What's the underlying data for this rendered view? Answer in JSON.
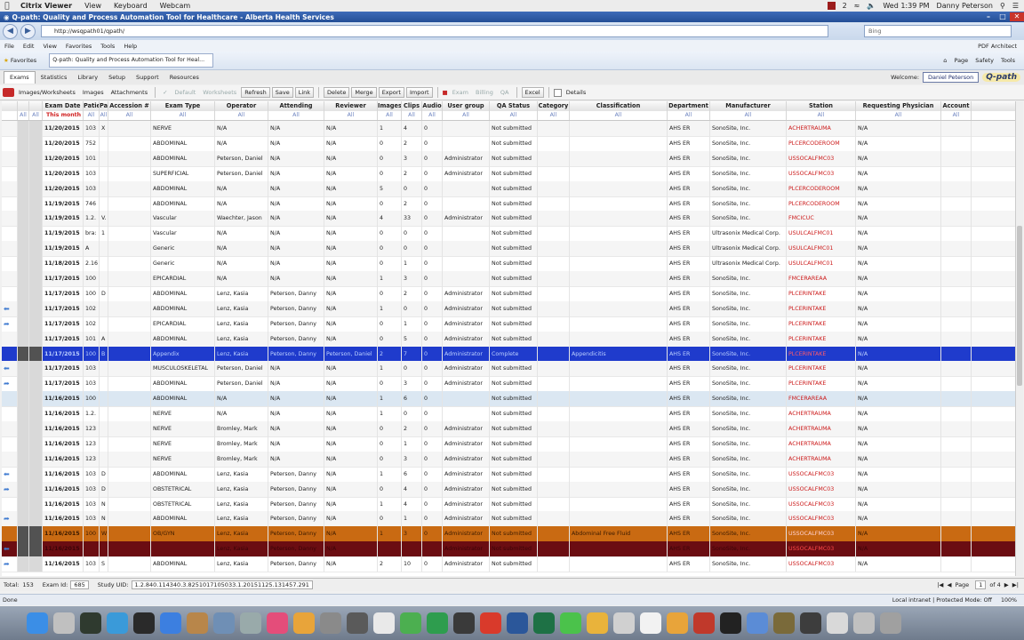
{
  "mac_menubar": {
    "app_name": "Citrix Viewer",
    "items": [
      "View",
      "Keyboard",
      "Webcam"
    ],
    "badge": "2",
    "clock": "Wed 1:39 PM",
    "user": "Danny Peterson"
  },
  "window": {
    "title": "Q-path: Quality and Process Automation Tool for Healthcare - Alberta Health Services"
  },
  "browser": {
    "url": "http://wsqpath01/qpath/",
    "search_placeholder": "Bing",
    "menu": [
      "File",
      "Edit",
      "View",
      "Favorites",
      "Tools",
      "Help"
    ],
    "pdf_architect": "PDF Architect",
    "favorites_label": "Favorites",
    "tab_title": "Q-path: Quality and Process Automation Tool for Heal...",
    "tools": [
      "Page",
      "Safety",
      "Tools"
    ]
  },
  "app": {
    "tabs": [
      "Exams",
      "Statistics",
      "Library",
      "Setup",
      "Support",
      "Resources"
    ],
    "welcome_label": "Welcome:",
    "user": "Daniel Peterson",
    "logo": "Q-path",
    "toolbar": {
      "images_worksheets": "Images/Worksheets",
      "images": "Images",
      "attachments": "Attachments",
      "default": "Default",
      "worksheets": "Worksheets",
      "refresh": "Refresh",
      "save": "Save",
      "link": "Link",
      "delete": "Delete",
      "merge": "Merge",
      "export": "Export",
      "import": "Import",
      "exam": "Exam",
      "billing": "Billing",
      "qa": "QA",
      "excel": "Excel",
      "details": "Details"
    }
  },
  "grid": {
    "columns": [
      "",
      "",
      "",
      "Exam Date",
      "Patie",
      "Pa",
      "Accession #",
      "Exam Type",
      "Operator",
      "Attending",
      "Reviewer",
      "Images",
      "Clips",
      "Audio",
      "User group",
      "QA Status",
      "Category",
      "Classification",
      "Department",
      "Manufacturer",
      "Station",
      "Requesting Physician",
      "Account"
    ],
    "filter_all": "All",
    "this_month": "This month",
    "rows": [
      {
        "style": "alt",
        "icon": "",
        "date": "11/20/2015",
        "pid": "103",
        "pa": "X",
        "acc": "",
        "type": "NERVE",
        "op": "N/A",
        "att": "N/A",
        "rev": "N/A",
        "img": "1",
        "clips": "4",
        "audio": "0",
        "ug": "",
        "qa": "Not submitted",
        "cat": "",
        "cls": "",
        "dept": "AHS ER",
        "mfr": "SonoSite, Inc.",
        "station": "ACHERTRAUMA",
        "req": "N/A"
      },
      {
        "style": "",
        "icon": "",
        "date": "11/20/2015",
        "pid": "752",
        "pa": "",
        "acc": "",
        "type": "ABDOMINAL",
        "op": "N/A",
        "att": "N/A",
        "rev": "N/A",
        "img": "0",
        "clips": "2",
        "audio": "0",
        "ug": "",
        "qa": "Not submitted",
        "cat": "",
        "cls": "",
        "dept": "AHS ER",
        "mfr": "SonoSite, Inc.",
        "station": "PLCERCODEROOM",
        "req": "N/A"
      },
      {
        "style": "alt",
        "icon": "",
        "date": "11/20/2015",
        "pid": "101",
        "pa": "",
        "acc": "",
        "type": "ABDOMINAL",
        "op": "Peterson, Daniel",
        "att": "N/A",
        "rev": "N/A",
        "img": "0",
        "clips": "3",
        "audio": "0",
        "ug": "Administrator",
        "qa": "Not submitted",
        "cat": "",
        "cls": "",
        "dept": "AHS ER",
        "mfr": "SonoSite, Inc.",
        "station": "USSOCALFMC03",
        "req": "N/A"
      },
      {
        "style": "",
        "icon": "",
        "date": "11/20/2015",
        "pid": "103",
        "pa": "",
        "acc": "",
        "type": "SUPERFICIAL",
        "op": "Peterson, Daniel",
        "att": "N/A",
        "rev": "N/A",
        "img": "0",
        "clips": "2",
        "audio": "0",
        "ug": "Administrator",
        "qa": "Not submitted",
        "cat": "",
        "cls": "",
        "dept": "AHS ER",
        "mfr": "SonoSite, Inc.",
        "station": "USSOCALFMC03",
        "req": "N/A"
      },
      {
        "style": "alt",
        "icon": "",
        "date": "11/20/2015",
        "pid": "103",
        "pa": "",
        "acc": "",
        "type": "ABDOMINAL",
        "op": "N/A",
        "att": "N/A",
        "rev": "N/A",
        "img": "5",
        "clips": "0",
        "audio": "0",
        "ug": "",
        "qa": "Not submitted",
        "cat": "",
        "cls": "",
        "dept": "AHS ER",
        "mfr": "SonoSite, Inc.",
        "station": "PLCERCODEROOM",
        "req": "N/A"
      },
      {
        "style": "",
        "icon": "",
        "date": "11/19/2015",
        "pid": "746",
        "pa": "",
        "acc": "",
        "type": "ABDOMINAL",
        "op": "N/A",
        "att": "N/A",
        "rev": "N/A",
        "img": "0",
        "clips": "2",
        "audio": "0",
        "ug": "",
        "qa": "Not submitted",
        "cat": "",
        "cls": "",
        "dept": "AHS ER",
        "mfr": "SonoSite, Inc.",
        "station": "PLCERCODEROOM",
        "req": "N/A"
      },
      {
        "style": "alt",
        "icon": "",
        "date": "11/19/2015",
        "pid": "1.2.",
        "pa": "V.",
        "acc": "",
        "type": "Vascular",
        "op": "Waechter, Jason",
        "att": "N/A",
        "rev": "N/A",
        "img": "4",
        "clips": "33",
        "audio": "0",
        "ug": "Administrator",
        "qa": "Not submitted",
        "cat": "",
        "cls": "",
        "dept": "AHS ER",
        "mfr": "SonoSite, Inc.",
        "station": "FMCICUC",
        "req": "N/A"
      },
      {
        "style": "",
        "icon": "",
        "date": "11/19/2015",
        "pid": "bra:",
        "pa": "1",
        "acc": "",
        "type": "Vascular",
        "op": "N/A",
        "att": "N/A",
        "rev": "N/A",
        "img": "0",
        "clips": "0",
        "audio": "0",
        "ug": "",
        "qa": "Not submitted",
        "cat": "",
        "cls": "",
        "dept": "AHS ER",
        "mfr": "Ultrasonix Medical Corp.",
        "station": "USULCALFMC01",
        "req": "N/A"
      },
      {
        "style": "alt",
        "icon": "",
        "date": "11/19/2015",
        "pid": "A",
        "pa": "",
        "acc": "",
        "type": "Generic",
        "op": "N/A",
        "att": "N/A",
        "rev": "N/A",
        "img": "0",
        "clips": "0",
        "audio": "0",
        "ug": "",
        "qa": "Not submitted",
        "cat": "",
        "cls": "",
        "dept": "AHS ER",
        "mfr": "Ultrasonix Medical Corp.",
        "station": "USULCALFMC01",
        "req": "N/A"
      },
      {
        "style": "",
        "icon": "",
        "date": "11/18/2015",
        "pid": "2.16",
        "pa": "",
        "acc": "",
        "type": "Generic",
        "op": "N/A",
        "att": "N/A",
        "rev": "N/A",
        "img": "0",
        "clips": "1",
        "audio": "0",
        "ug": "",
        "qa": "Not submitted",
        "cat": "",
        "cls": "",
        "dept": "AHS ER",
        "mfr": "Ultrasonix Medical Corp.",
        "station": "USULCALFMC01",
        "req": "N/A"
      },
      {
        "style": "alt",
        "icon": "",
        "date": "11/17/2015",
        "pid": "100",
        "pa": "",
        "acc": "",
        "type": "EPICARDIAL",
        "op": "N/A",
        "att": "N/A",
        "rev": "N/A",
        "img": "1",
        "clips": "3",
        "audio": "0",
        "ug": "",
        "qa": "Not submitted",
        "cat": "",
        "cls": "",
        "dept": "AHS ER",
        "mfr": "SonoSite, Inc.",
        "station": "FMCERAREAA",
        "req": "N/A"
      },
      {
        "style": "",
        "icon": "",
        "date": "11/17/2015",
        "pid": "100",
        "pa": "D",
        "acc": "",
        "type": "ABDOMINAL",
        "op": "Lenz, Kasia",
        "att": "Peterson, Danny",
        "rev": "N/A",
        "img": "0",
        "clips": "2",
        "audio": "0",
        "ug": "Administrator",
        "qa": "Not submitted",
        "cat": "",
        "cls": "",
        "dept": "AHS ER",
        "mfr": "SonoSite, Inc.",
        "station": "PLCERINTAKE",
        "req": "N/A"
      },
      {
        "style": "alt",
        "icon": "back",
        "date": "11/17/2015",
        "pid": "102",
        "pa": "",
        "acc": "",
        "type": "ABDOMINAL",
        "op": "Lenz, Kasia",
        "att": "Peterson, Danny",
        "rev": "N/A",
        "img": "1",
        "clips": "0",
        "audio": "0",
        "ug": "Administrator",
        "qa": "Not submitted",
        "cat": "",
        "cls": "",
        "dept": "AHS ER",
        "mfr": "SonoSite, Inc.",
        "station": "PLCERINTAKE",
        "req": "N/A"
      },
      {
        "style": "",
        "icon": "fwd",
        "date": "11/17/2015",
        "pid": "102",
        "pa": "",
        "acc": "",
        "type": "EPICARDIAL",
        "op": "Lenz, Kasia",
        "att": "Peterson, Danny",
        "rev": "N/A",
        "img": "0",
        "clips": "1",
        "audio": "0",
        "ug": "Administrator",
        "qa": "Not submitted",
        "cat": "",
        "cls": "",
        "dept": "AHS ER",
        "mfr": "SonoSite, Inc.",
        "station": "PLCERINTAKE",
        "req": "N/A"
      },
      {
        "style": "alt",
        "icon": "",
        "date": "11/17/2015",
        "pid": "101",
        "pa": "A",
        "acc": "",
        "type": "ABDOMINAL",
        "op": "Lenz, Kasia",
        "att": "Peterson, Danny",
        "rev": "N/A",
        "img": "0",
        "clips": "5",
        "audio": "0",
        "ug": "Administrator",
        "qa": "Not submitted",
        "cat": "",
        "cls": "",
        "dept": "AHS ER",
        "mfr": "SonoSite, Inc.",
        "station": "PLCERINTAKE",
        "req": "N/A"
      },
      {
        "style": "blue",
        "icon": "",
        "date": "11/17/2015",
        "pid": "100",
        "pa": "B",
        "acc": "",
        "type": "Appendix",
        "op": "Lenz, Kasia",
        "att": "Peterson, Danny",
        "rev": "Peterson, Daniel",
        "img": "2",
        "clips": "7",
        "audio": "0",
        "ug": "Administrator",
        "qa": "Complete",
        "cat": "",
        "cls": "Appendicitis",
        "dept": "AHS ER",
        "mfr": "SonoSite, Inc.",
        "station": "PLCERINTAKE",
        "req": "N/A"
      },
      {
        "style": "alt",
        "icon": "back",
        "date": "11/17/2015",
        "pid": "103",
        "pa": "",
        "acc": "",
        "type": "MUSCULOSKELETAL",
        "op": "Peterson, Daniel",
        "att": "N/A",
        "rev": "N/A",
        "img": "1",
        "clips": "0",
        "audio": "0",
        "ug": "Administrator",
        "qa": "Not submitted",
        "cat": "",
        "cls": "",
        "dept": "AHS ER",
        "mfr": "SonoSite, Inc.",
        "station": "PLCERINTAKE",
        "req": "N/A"
      },
      {
        "style": "",
        "icon": "fwd",
        "date": "11/17/2015",
        "pid": "103",
        "pa": "",
        "acc": "",
        "type": "ABDOMINAL",
        "op": "Peterson, Daniel",
        "att": "N/A",
        "rev": "N/A",
        "img": "0",
        "clips": "3",
        "audio": "0",
        "ug": "Administrator",
        "qa": "Not submitted",
        "cat": "",
        "cls": "",
        "dept": "AHS ER",
        "mfr": "SonoSite, Inc.",
        "station": "PLCERINTAKE",
        "req": "N/A"
      },
      {
        "style": "lb",
        "icon": "",
        "date": "11/16/2015",
        "pid": "100",
        "pa": "",
        "acc": "",
        "type": "ABDOMINAL",
        "op": "N/A",
        "att": "N/A",
        "rev": "N/A",
        "img": "1",
        "clips": "6",
        "audio": "0",
        "ug": "",
        "qa": "Not submitted",
        "cat": "",
        "cls": "",
        "dept": "AHS ER",
        "mfr": "SonoSite, Inc.",
        "station": "FMCERAREAA",
        "req": "N/A"
      },
      {
        "style": "",
        "icon": "",
        "date": "11/16/2015",
        "pid": "1.2.",
        "pa": "",
        "acc": "",
        "type": "NERVE",
        "op": "N/A",
        "att": "N/A",
        "rev": "N/A",
        "img": "1",
        "clips": "0",
        "audio": "0",
        "ug": "",
        "qa": "Not submitted",
        "cat": "",
        "cls": "",
        "dept": "AHS ER",
        "mfr": "SonoSite, Inc.",
        "station": "ACHERTRAUMA",
        "req": "N/A"
      },
      {
        "style": "alt",
        "icon": "",
        "date": "11/16/2015",
        "pid": "123",
        "pa": "",
        "acc": "",
        "type": "NERVE",
        "op": "Bromley, Mark",
        "att": "N/A",
        "rev": "N/A",
        "img": "0",
        "clips": "2",
        "audio": "0",
        "ug": "Administrator",
        "qa": "Not submitted",
        "cat": "",
        "cls": "",
        "dept": "AHS ER",
        "mfr": "SonoSite, Inc.",
        "station": "ACHERTRAUMA",
        "req": "N/A"
      },
      {
        "style": "",
        "icon": "",
        "date": "11/16/2015",
        "pid": "123",
        "pa": "",
        "acc": "",
        "type": "NERVE",
        "op": "Bromley, Mark",
        "att": "N/A",
        "rev": "N/A",
        "img": "0",
        "clips": "1",
        "audio": "0",
        "ug": "Administrator",
        "qa": "Not submitted",
        "cat": "",
        "cls": "",
        "dept": "AHS ER",
        "mfr": "SonoSite, Inc.",
        "station": "ACHERTRAUMA",
        "req": "N/A"
      },
      {
        "style": "alt",
        "icon": "",
        "date": "11/16/2015",
        "pid": "123",
        "pa": "",
        "acc": "",
        "type": "NERVE",
        "op": "Bromley, Mark",
        "att": "N/A",
        "rev": "N/A",
        "img": "0",
        "clips": "3",
        "audio": "0",
        "ug": "Administrator",
        "qa": "Not submitted",
        "cat": "",
        "cls": "",
        "dept": "AHS ER",
        "mfr": "SonoSite, Inc.",
        "station": "ACHERTRAUMA",
        "req": "N/A"
      },
      {
        "style": "",
        "icon": "back",
        "date": "11/16/2015",
        "pid": "103",
        "pa": "D",
        "acc": "",
        "type": "ABDOMINAL",
        "op": "Lenz, Kasia",
        "att": "Peterson, Danny",
        "rev": "N/A",
        "img": "1",
        "clips": "6",
        "audio": "0",
        "ug": "Administrator",
        "qa": "Not submitted",
        "cat": "",
        "cls": "",
        "dept": "AHS ER",
        "mfr": "SonoSite, Inc.",
        "station": "USSOCALFMC03",
        "req": "N/A"
      },
      {
        "style": "alt",
        "icon": "fwd",
        "date": "11/16/2015",
        "pid": "103",
        "pa": "D",
        "acc": "",
        "type": "OBSTETRICAL",
        "op": "Lenz, Kasia",
        "att": "Peterson, Danny",
        "rev": "N/A",
        "img": "0",
        "clips": "4",
        "audio": "0",
        "ug": "Administrator",
        "qa": "Not submitted",
        "cat": "",
        "cls": "",
        "dept": "AHS ER",
        "mfr": "SonoSite, Inc.",
        "station": "USSOCALFMC03",
        "req": "N/A"
      },
      {
        "style": "",
        "icon": "",
        "date": "11/16/2015",
        "pid": "103",
        "pa": "N",
        "acc": "",
        "type": "OBSTETRICAL",
        "op": "Lenz, Kasia",
        "att": "Peterson, Danny",
        "rev": "N/A",
        "img": "1",
        "clips": "4",
        "audio": "0",
        "ug": "Administrator",
        "qa": "Not submitted",
        "cat": "",
        "cls": "",
        "dept": "AHS ER",
        "mfr": "SonoSite, Inc.",
        "station": "USSOCALFMC03",
        "req": "N/A"
      },
      {
        "style": "alt",
        "icon": "fwd",
        "date": "11/16/2015",
        "pid": "103",
        "pa": "N",
        "acc": "",
        "type": "ABDOMINAL",
        "op": "Lenz, Kasia",
        "att": "Peterson, Danny",
        "rev": "N/A",
        "img": "0",
        "clips": "1",
        "audio": "0",
        "ug": "Administrator",
        "qa": "Not submitted",
        "cat": "",
        "cls": "",
        "dept": "AHS ER",
        "mfr": "SonoSite, Inc.",
        "station": "USSOCALFMC03",
        "req": "N/A"
      },
      {
        "style": "orange",
        "icon": "",
        "date": "11/16/2015",
        "pid": "100",
        "pa": "W",
        "acc": "",
        "type": "OB/GYN",
        "op": "Lenz, Kasia",
        "att": "Peterson, Danny",
        "rev": "N/A",
        "img": "1",
        "clips": "3",
        "audio": "0",
        "ug": "Administrator",
        "qa": "Not submitted",
        "cat": "",
        "cls": "Abdominal Free Fluid",
        "dept": "AHS ER",
        "mfr": "SonoSite, Inc.",
        "station": "USSOCALFMC03",
        "req": "N/A"
      },
      {
        "style": "maroon",
        "icon": "back",
        "date": "11/16/2015",
        "pid": "",
        "pa": "",
        "acc": "",
        "type": "",
        "op": "Lenz, Kasia",
        "att": "Peterson, Danny",
        "rev": "N/A",
        "img": "",
        "clips": "",
        "audio": "",
        "ug": "Administrator",
        "qa": "Not submitted",
        "cat": "",
        "cls": "",
        "dept": "AHS ER",
        "mfr": "SonoSite, Inc.",
        "station": "USSOCALFMC03",
        "req": "N/A"
      },
      {
        "style": "",
        "icon": "fwd",
        "date": "11/16/2015",
        "pid": "103",
        "pa": "S",
        "acc": "",
        "type": "ABDOMINAL",
        "op": "Lenz, Kasia",
        "att": "Peterson, Danny",
        "rev": "N/A",
        "img": "2",
        "clips": "10",
        "audio": "0",
        "ug": "Administrator",
        "qa": "Not submitted",
        "cat": "",
        "cls": "",
        "dept": "AHS ER",
        "mfr": "SonoSite, Inc.",
        "station": "USSOCALFMC03",
        "req": "N/A"
      }
    ]
  },
  "status": {
    "total_label": "Total:",
    "total": "153",
    "exam_id_label": "Exam Id:",
    "exam_id": "685",
    "study_uid_label": "Study UID:",
    "study_uid": "1.2.840.114340.3.8251017105033.1.20151125.131457.291",
    "page_label": "Page",
    "page": "1",
    "of_label": "of 4"
  },
  "ie_status": {
    "left": "Done",
    "zone": "Local intranet | Protected Mode: Off",
    "zoom": "100%"
  }
}
